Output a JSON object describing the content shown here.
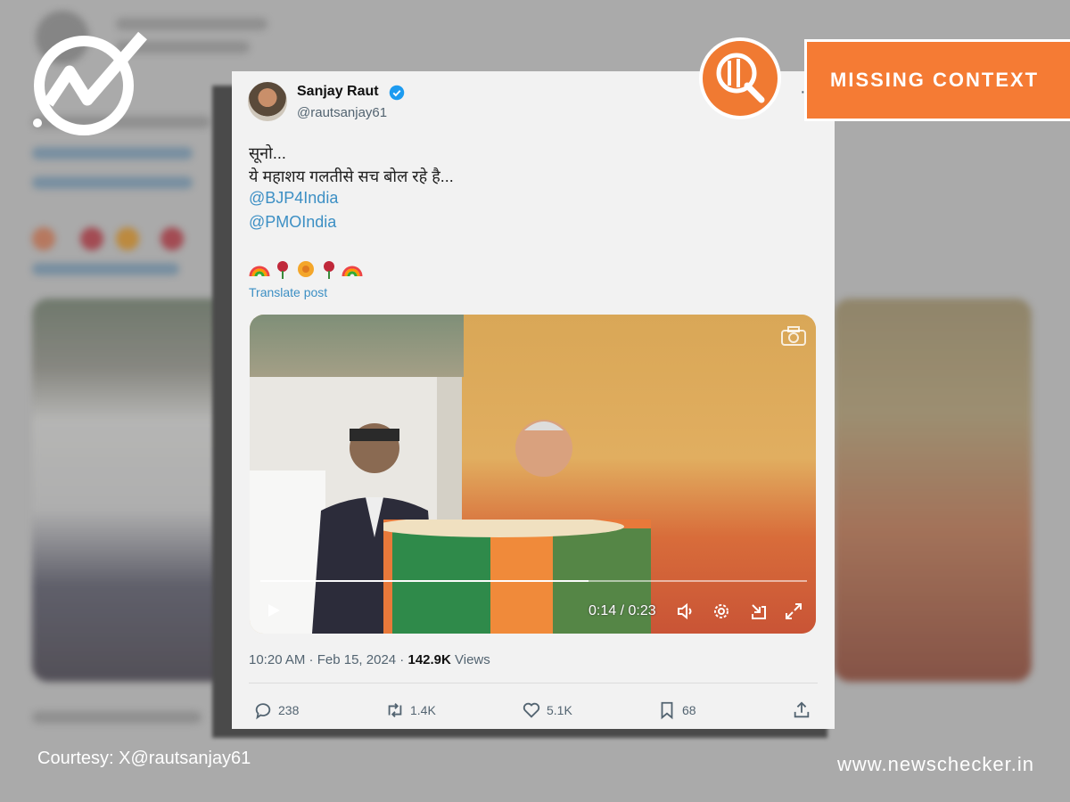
{
  "tweet": {
    "author_name": "Sanjay Raut",
    "handle": "@rautsanjay61",
    "menu": "···",
    "line1": "सूनो...",
    "line2": "ये महाशय गलतीसे सच बोल रहे है...",
    "mention1": "@BJP4India",
    "mention2": "@PMOIndia",
    "translate": "Translate post",
    "time": "10:20 AM",
    "sep": " · ",
    "date": "Feb 15, 2024",
    "sep2": " · ",
    "views_count": "142.9K",
    "views_label": " Views"
  },
  "video": {
    "time": "0:14 / 0:23",
    "progress": 0.6
  },
  "actions": {
    "replies": "238",
    "reposts": "1.4K",
    "likes": "5.1K",
    "bookmarks": "68"
  },
  "badge": {
    "label": "MISSING CONTEXT",
    "color": "#f57b34"
  },
  "footer": {
    "courtesy": "Courtesy: X@rautsanjay61",
    "site": "www.newschecker.in"
  },
  "icons": [
    "newschecker-logo-icon",
    "verified-icon",
    "play-icon",
    "volume-icon",
    "settings-icon",
    "minimize-icon",
    "fullscreen-icon",
    "camera-icon",
    "reply-icon",
    "repost-icon",
    "like-icon",
    "bookmark-icon",
    "share-icon",
    "magnifier-badge-icon"
  ]
}
